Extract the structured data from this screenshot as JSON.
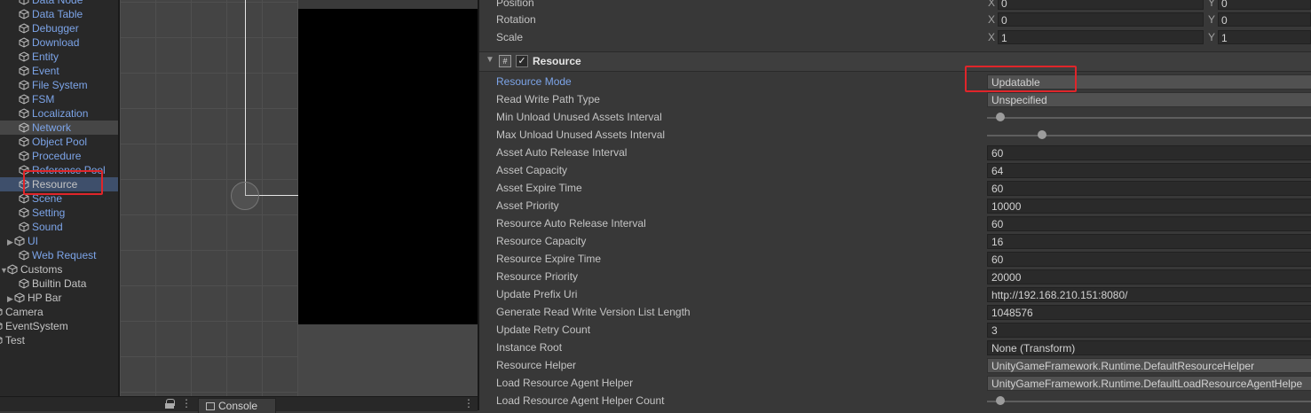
{
  "hierarchy": {
    "items": [
      {
        "label": "Data Node",
        "color": "blue",
        "kind": "cube",
        "fold": ""
      },
      {
        "label": "Data Table",
        "color": "blue",
        "kind": "cube",
        "fold": ""
      },
      {
        "label": "Debugger",
        "color": "blue",
        "kind": "cube",
        "fold": ""
      },
      {
        "label": "Download",
        "color": "blue",
        "kind": "cube",
        "fold": ""
      },
      {
        "label": "Entity",
        "color": "blue",
        "kind": "cube",
        "fold": ""
      },
      {
        "label": "Event",
        "color": "blue",
        "kind": "cube",
        "fold": ""
      },
      {
        "label": "File System",
        "color": "blue",
        "kind": "cube",
        "fold": ""
      },
      {
        "label": "FSM",
        "color": "blue",
        "kind": "cube",
        "fold": ""
      },
      {
        "label": "Localization",
        "color": "blue",
        "kind": "cube",
        "fold": ""
      },
      {
        "label": "Network",
        "color": "blue",
        "kind": "cube",
        "fold": "",
        "hl": true
      },
      {
        "label": "Object Pool",
        "color": "blue",
        "kind": "cube",
        "fold": ""
      },
      {
        "label": "Procedure",
        "color": "blue",
        "kind": "cube",
        "fold": ""
      },
      {
        "label": "Reference Pool",
        "color": "blue",
        "kind": "cube",
        "fold": ""
      },
      {
        "label": "Resource",
        "color": "white",
        "kind": "cube",
        "fold": "",
        "selected": true
      },
      {
        "label": "Scene",
        "color": "blue",
        "kind": "cube",
        "fold": ""
      },
      {
        "label": "Setting",
        "color": "blue",
        "kind": "cube",
        "fold": ""
      },
      {
        "label": "Sound",
        "color": "blue",
        "kind": "cube",
        "fold": ""
      },
      {
        "label": "UI",
        "color": "blue",
        "kind": "cube",
        "fold": "▶"
      },
      {
        "label": "Web Request",
        "color": "blue",
        "kind": "cube",
        "fold": ""
      },
      {
        "label": "Customs",
        "color": "white",
        "kind": "cube",
        "fold": "▼",
        "indent": 0
      },
      {
        "label": "Builtin Data",
        "color": "white",
        "kind": "cube",
        "fold": ""
      },
      {
        "label": "HP Bar",
        "color": "white",
        "kind": "cube",
        "fold": "▶"
      },
      {
        "label": "Camera",
        "color": "white",
        "kind": "cube",
        "fold": "",
        "indent": -1
      },
      {
        "label": "EventSystem",
        "color": "white",
        "kind": "cube",
        "fold": "",
        "indent": -1
      },
      {
        "label": "Test",
        "color": "white",
        "kind": "cube",
        "fold": "",
        "indent": -1
      }
    ]
  },
  "bottom_bar": {
    "console_tab": "Console",
    "lock_icon": "lock-icon",
    "menu_icon": "kebab-menu-icon"
  },
  "transform": {
    "position_label": "Position",
    "rotation_label": "Rotation",
    "scale_label": "Scale",
    "x": "X",
    "y": "Y",
    "position": [
      "0",
      "0"
    ],
    "rotation": [
      "0",
      "0"
    ],
    "scale": [
      "1",
      "1"
    ]
  },
  "component": {
    "title": "Resource",
    "enabled": true,
    "script_icon": "#",
    "checkmark": "✓"
  },
  "properties": [
    {
      "label": "Resource Mode",
      "type": "dropdown",
      "value": "Updatable",
      "blue": true
    },
    {
      "label": "Read Write Path Type",
      "type": "dropdown",
      "value": "Unspecified"
    },
    {
      "label": "Min Unload Unused Assets Interval",
      "type": "slider",
      "level": 0.04
    },
    {
      "label": "Max Unload Unused Assets Interval",
      "type": "slider",
      "level": 0.17
    },
    {
      "label": "Asset Auto Release Interval",
      "type": "field",
      "value": "60"
    },
    {
      "label": "Asset Capacity",
      "type": "field",
      "value": "64"
    },
    {
      "label": "Asset Expire Time",
      "type": "field",
      "value": "60"
    },
    {
      "label": "Asset Priority",
      "type": "field",
      "value": "10000"
    },
    {
      "label": "Resource Auto Release Interval",
      "type": "field",
      "value": "60"
    },
    {
      "label": "Resource Capacity",
      "type": "field",
      "value": "16"
    },
    {
      "label": "Resource Expire Time",
      "type": "field",
      "value": "60"
    },
    {
      "label": "Resource Priority",
      "type": "field",
      "value": "20000"
    },
    {
      "label": "Update Prefix Uri",
      "type": "field",
      "value": "http://192.168.210.151:8080/"
    },
    {
      "label": "Generate Read Write Version List Length",
      "type": "field",
      "value": "1048576"
    },
    {
      "label": "Update Retry Count",
      "type": "field",
      "value": "3"
    },
    {
      "label": "Instance Root",
      "type": "field",
      "value": "None (Transform)"
    },
    {
      "label": "Resource Helper",
      "type": "dropdown",
      "value": "UnityGameFramework.Runtime.DefaultResourceHelper"
    },
    {
      "label": "Load Resource Agent Helper",
      "type": "dropdown",
      "value": "UnityGameFramework.Runtime.DefaultLoadResourceAgentHelpe"
    },
    {
      "label": "Load Resource Agent Helper Count",
      "type": "slider",
      "level": 0.04
    }
  ],
  "colors": {
    "accent_blue": "#7ca4e8",
    "annotation_red": "#e0252a",
    "selected_row": "#3e4f6b"
  }
}
